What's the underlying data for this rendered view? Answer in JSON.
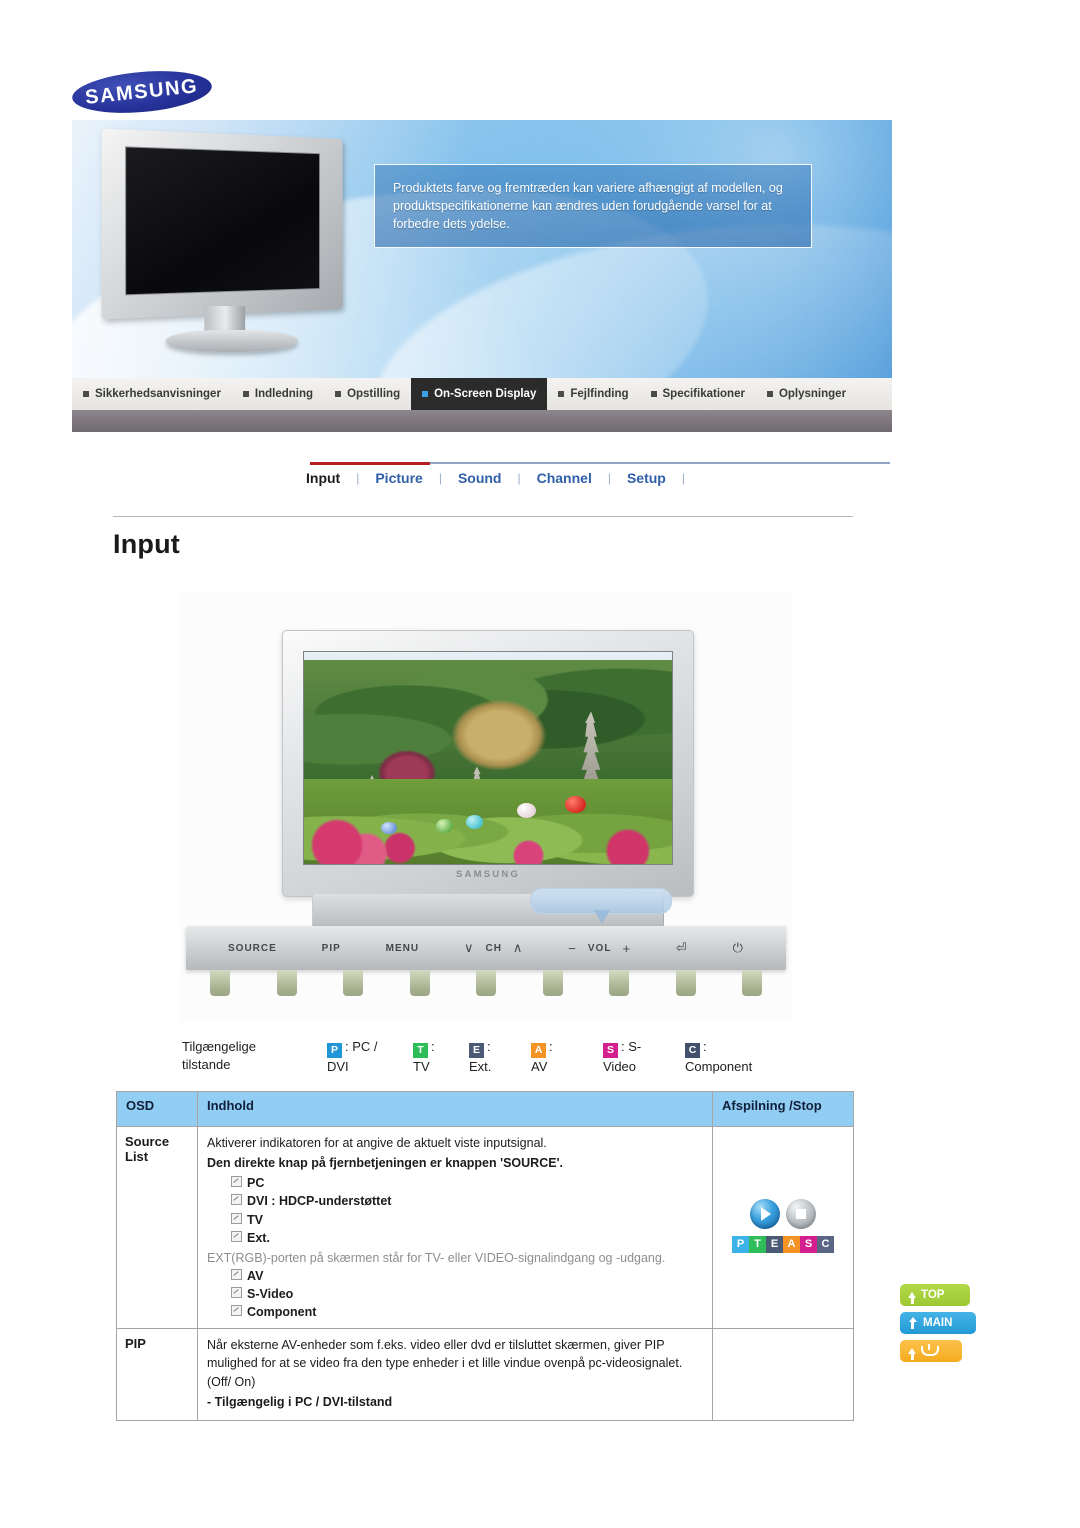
{
  "brand": {
    "logo_text": "SAMSUNG"
  },
  "hero": {
    "note": "Produktets farve og fremtræden kan variere afhængigt af modellen, og produktspecifikationerne kan ændres uden forudgående varsel for at forbedre dets ydelse."
  },
  "nav": {
    "items": [
      {
        "label": "Sikkerhedsanvisninger",
        "active": false
      },
      {
        "label": "Indledning",
        "active": false
      },
      {
        "label": "Opstilling",
        "active": false
      },
      {
        "label": "On-Screen Display",
        "active": true
      },
      {
        "label": "Fejlfinding",
        "active": false
      },
      {
        "label": "Specifikationer",
        "active": false
      },
      {
        "label": "Oplysninger",
        "active": false
      }
    ]
  },
  "subtabs": {
    "items": [
      {
        "label": "Input",
        "active": true
      },
      {
        "label": "Picture",
        "active": false
      },
      {
        "label": "Sound",
        "active": false
      },
      {
        "label": "Channel",
        "active": false
      },
      {
        "label": "Setup",
        "active": false
      }
    ],
    "separator": "|"
  },
  "page_title": "Input",
  "monitor": {
    "brand": "SAMSUNG",
    "controls": {
      "source": "SOURCE",
      "pip": "PIP",
      "menu": "MENU",
      "ch_down": "∨",
      "ch": "CH",
      "ch_up": "∧",
      "vol_minus": "−",
      "vol": "VOL",
      "vol_plus": "+",
      "enter": "⏎",
      "power": "⏻"
    }
  },
  "modes": {
    "label_line1": "Tilgængelige",
    "label_line2": "tilstande",
    "items": [
      {
        "key": "P",
        "color": "#2196d6",
        "text_line1": ": PC /",
        "text_line2": "DVI"
      },
      {
        "key": "T",
        "color": "#2fbd5a",
        "text_line1": ":",
        "text_line2": "TV"
      },
      {
        "key": "E",
        "color": "#4a5a74",
        "text_line1": ":",
        "text_line2": "Ext."
      },
      {
        "key": "A",
        "color": "#f59425",
        "text_line1": ":",
        "text_line2": "AV"
      },
      {
        "key": "S",
        "color": "#d41f8e",
        "text_line1": ": S-",
        "text_line2": "Video"
      },
      {
        "key": "C",
        "color": "#43506c",
        "text_line1": ":",
        "text_line2": "Component"
      }
    ]
  },
  "table": {
    "headers": {
      "osd": "OSD",
      "content": "Indhold",
      "playstop": "Afspilning /Stop"
    },
    "header_bg": "#92cdf4",
    "rows": [
      {
        "osd_line1": "Source",
        "osd_line2": "List",
        "lead": "Aktiverer indikatoren for at angive de aktuelt viste inputsignal.",
        "bold_line": "Den direkte knap på fjernbetjeningen er knappen 'SOURCE'.",
        "bullets": [
          {
            "text": "PC"
          },
          {
            "text": "DVI : HDCP-understøttet"
          },
          {
            "text": "TV"
          },
          {
            "text": "Ext."
          }
        ],
        "note": "EXT(RGB)-porten på skærmen står for TV- eller VIDEO-signalindgang og -udgang.",
        "bullets2": [
          {
            "text": "AV"
          },
          {
            "text": "S-Video"
          },
          {
            "text": "Component"
          }
        ],
        "playstop": {
          "play_icon": "play-icon",
          "stop_icon": "stop-icon",
          "strip": [
            {
              "key": "P",
              "color": "#3bb3e8"
            },
            {
              "key": "T",
              "color": "#2fbd5a"
            },
            {
              "key": "E",
              "color": "#4a5a74"
            },
            {
              "key": "A",
              "color": "#f59425"
            },
            {
              "key": "S",
              "color": "#d41f8e"
            },
            {
              "key": "C",
              "color": "#5a6684"
            }
          ]
        }
      },
      {
        "osd_line1": "PIP",
        "osd_line2": "",
        "lead": "Når eksterne AV-enheder som f.eks. video eller dvd er tilsluttet skærmen, giver PIP mulighed for at se video fra den type enheder i et lille vindue ovenpå pc-videosignalet. (Off/ On)",
        "bold_line": "- Tilgængelig i PC / DVI-tilstand"
      }
    ]
  },
  "side_buttons": [
    {
      "label": "TOP",
      "icon": "arrow-up-icon",
      "color": "#a8d23f"
    },
    {
      "label": "MAIN",
      "icon": "arrow-bend-icon",
      "color": "#2ba4dc"
    },
    {
      "label": "",
      "icon": "bookmark-icon",
      "color": "#f7b22e"
    }
  ]
}
